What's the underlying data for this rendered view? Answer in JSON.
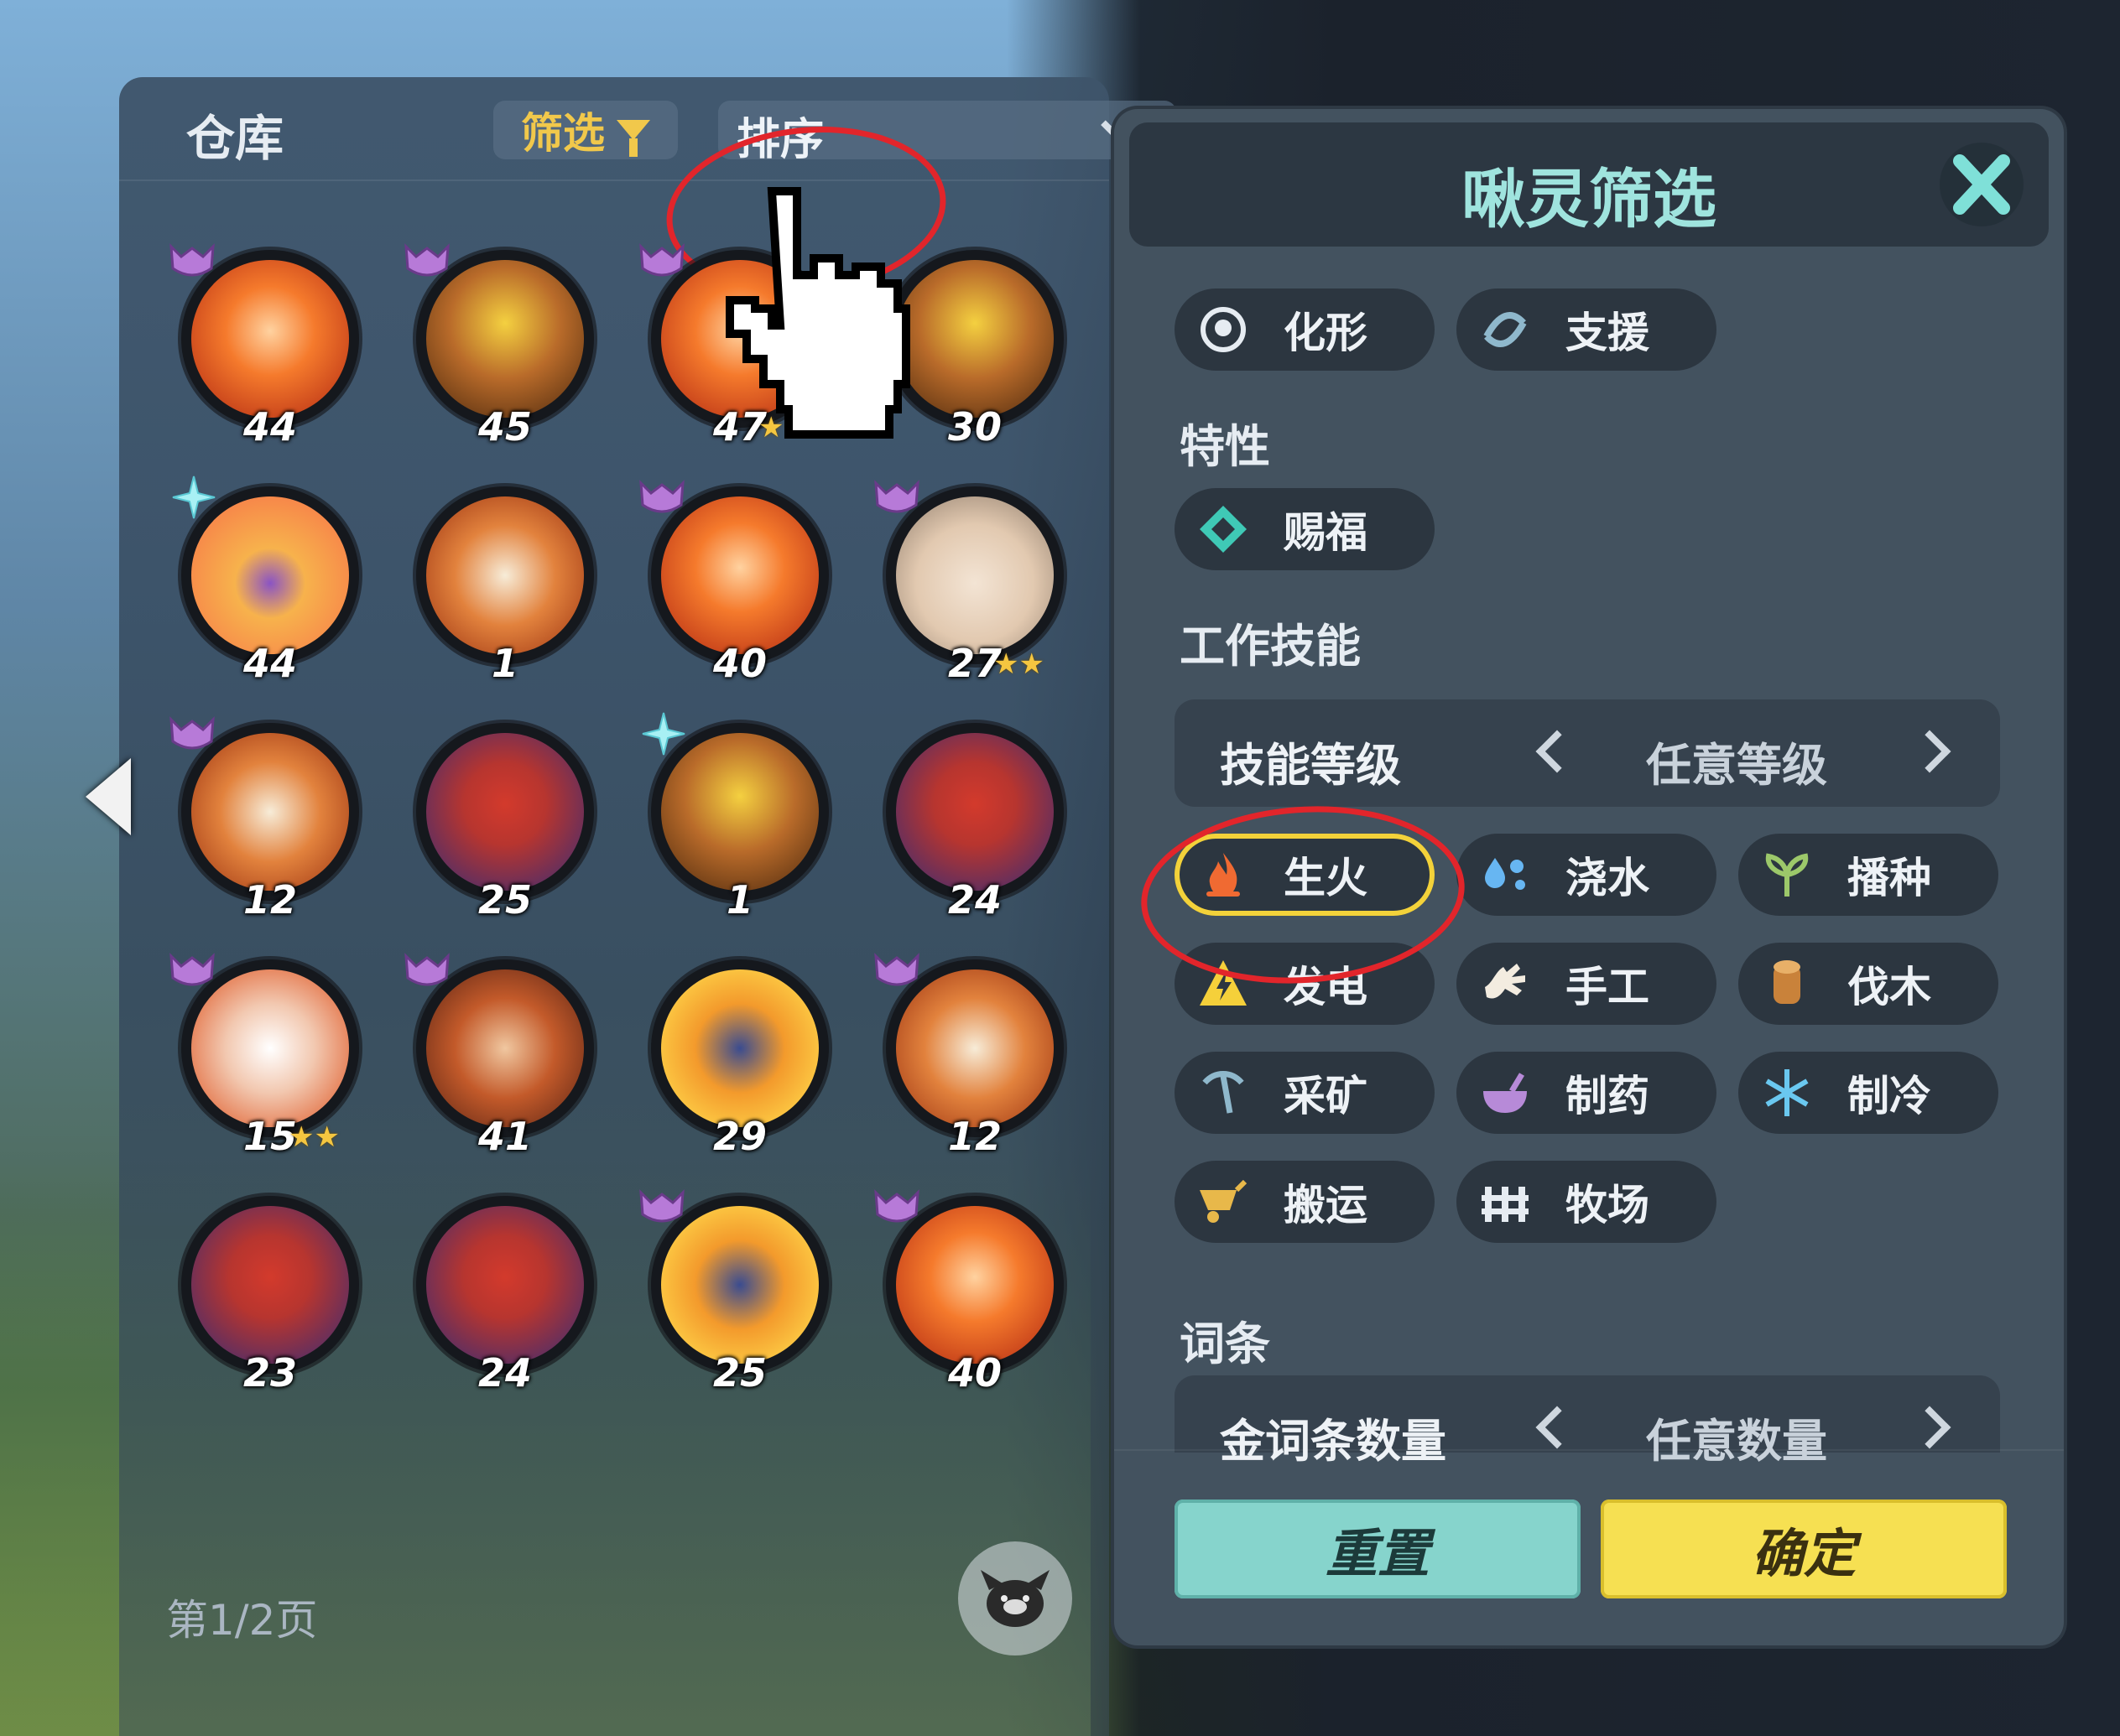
{
  "storage": {
    "title": "仓库",
    "filter_label": "筛选",
    "sort_label": "排序",
    "page_indicator": "第1/2页"
  },
  "pals": [
    {
      "level": "44",
      "art": "fire",
      "badge": "alpha"
    },
    {
      "level": "45",
      "art": "deer",
      "badge": "alpha"
    },
    {
      "level": "47",
      "art": "fire",
      "badge": "alpha",
      "stars": "★"
    },
    {
      "level": "30",
      "art": "deer",
      "badge": ""
    },
    {
      "level": "44",
      "art": "flower",
      "badge": "spark"
    },
    {
      "level": "1",
      "art": "fox",
      "badge": ""
    },
    {
      "level": "40",
      "art": "fire",
      "badge": "alpha"
    },
    {
      "level": "27",
      "art": "candle",
      "badge": "alpha",
      "stars": "★★"
    },
    {
      "level": "12",
      "art": "fox",
      "badge": "alpha"
    },
    {
      "level": "25",
      "art": "bulb",
      "badge": ""
    },
    {
      "level": "1",
      "art": "deer",
      "badge": "spark"
    },
    {
      "level": "24",
      "art": "bulb",
      "badge": ""
    },
    {
      "level": "15",
      "art": "white",
      "badge": "alpha",
      "stars": "★★"
    },
    {
      "level": "41",
      "art": "raccoon",
      "badge": "alpha"
    },
    {
      "level": "29",
      "art": "lion",
      "badge": ""
    },
    {
      "level": "12",
      "art": "fox",
      "badge": "alpha"
    },
    {
      "level": "23",
      "art": "bulb",
      "badge": ""
    },
    {
      "level": "24",
      "art": "bulb",
      "badge": ""
    },
    {
      "level": "25",
      "art": "lion",
      "badge": "alpha"
    },
    {
      "level": "40",
      "art": "fire",
      "badge": "alpha"
    }
  ],
  "filter_panel": {
    "title": "啾灵筛选",
    "top_chips": [
      {
        "label": "化形",
        "icon": "transform-icon"
      },
      {
        "label": "支援",
        "icon": "support-icon"
      }
    ],
    "trait_label": "特性",
    "trait_chips": [
      {
        "label": "赐福",
        "icon": "blessing-icon"
      }
    ],
    "work_label": "工作技能",
    "skill_level": {
      "label": "技能等级",
      "value": "任意等级"
    },
    "skills": [
      {
        "label": "生火",
        "icon": "fire-icon",
        "selected": true
      },
      {
        "label": "浇水",
        "icon": "water-icon"
      },
      {
        "label": "播种",
        "icon": "sprout-icon"
      },
      {
        "label": "发电",
        "icon": "electric-icon"
      },
      {
        "label": "手工",
        "icon": "handiwork-icon"
      },
      {
        "label": "伐木",
        "icon": "log-icon"
      },
      {
        "label": "采矿",
        "icon": "pickaxe-icon"
      },
      {
        "label": "制药",
        "icon": "medicine-icon"
      },
      {
        "label": "制冷",
        "icon": "snowflake-icon"
      },
      {
        "label": "搬运",
        "icon": "cart-icon"
      },
      {
        "label": "牧场",
        "icon": "ranch-icon"
      }
    ],
    "affix_label": "词条",
    "gold_affix": {
      "label": "金词条数量",
      "value": "任意数量"
    },
    "reset_label": "重置",
    "confirm_label": "确定"
  },
  "colors": {
    "accent_teal": "#9fe4de",
    "confirm_yellow": "#f6e052",
    "reset_teal": "#86d4cc",
    "annotation_red": "#e2252b",
    "selected_outline": "#f3d23a"
  }
}
